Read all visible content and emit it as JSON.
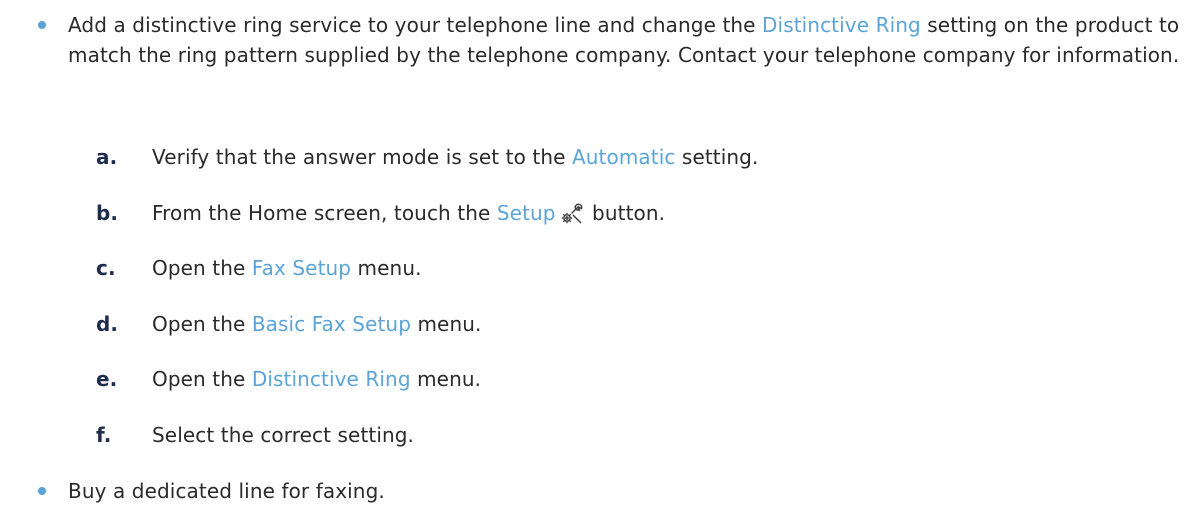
{
  "intro": {
    "before": "Add a distinctive ring service to your telephone line and change the ",
    "link": "Distinctive Ring",
    "after": " setting on the product to match the ring pattern supplied by the telephone company. Contact your telephone company for information."
  },
  "steps": [
    {
      "letter": "a.",
      "before": "Verify that the answer mode is set to the ",
      "link": "Automatic",
      "after": " setting."
    },
    {
      "letter": "b.",
      "before": "From the Home screen, touch the ",
      "link": "Setup",
      "icon": "setup-icon",
      "after": " button."
    },
    {
      "letter": "c.",
      "before": "Open the ",
      "link": "Fax Setup",
      "after": " menu."
    },
    {
      "letter": "d.",
      "before": "Open the ",
      "link": "Basic Fax Setup",
      "after": " menu."
    },
    {
      "letter": "e.",
      "before": "Open the ",
      "link": "Distinctive Ring",
      "after": " menu."
    },
    {
      "letter": "f.",
      "text": "Select the correct setting."
    }
  ],
  "final_bullet": "Buy a dedicated line for faxing.",
  "colors": {
    "link": "#5ba4d8",
    "bullet": "#5ba4d8",
    "step_letter": "#1f2d4d",
    "text": "#2a2a2a"
  }
}
